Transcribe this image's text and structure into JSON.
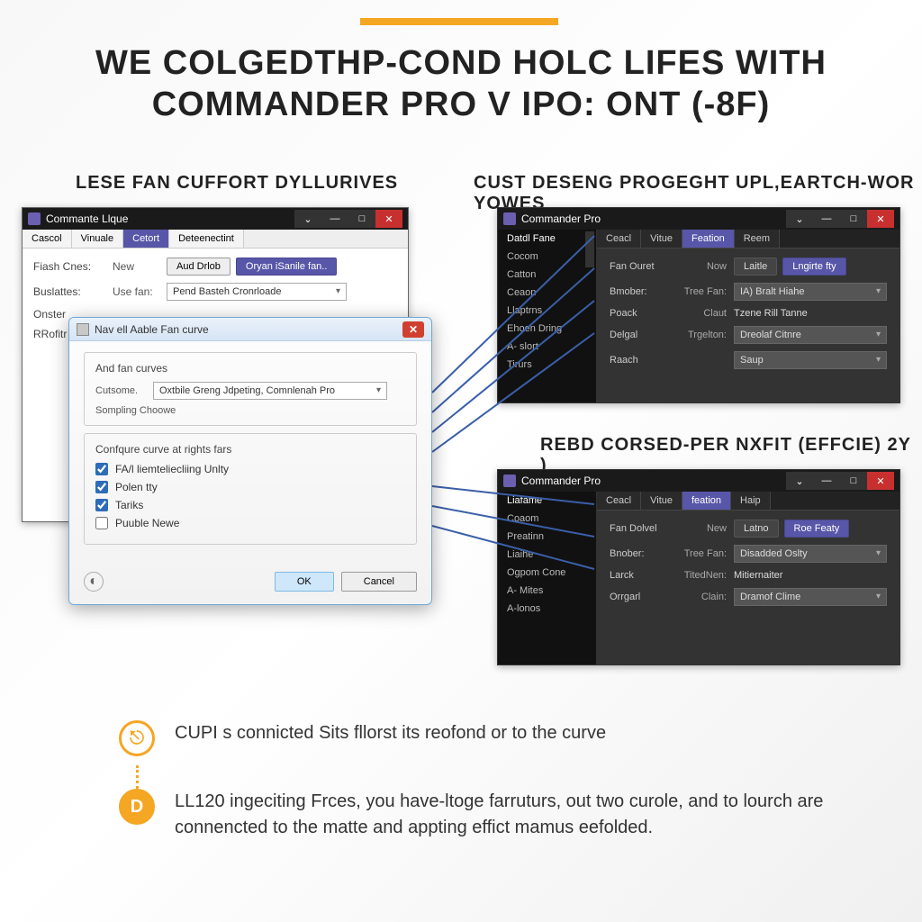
{
  "headline_line1": "WE COLGEDTHP-COND HOLC LIFES WITH",
  "headline_line2": "COMMANDER PRO V IPO: ONT (-8F)",
  "section_left": "LESE FAN CUFFORT DYLLURIVES",
  "section_right_1": "CUST DESENG PROGEGHT UPL,EARTCH-WOR YOWES",
  "section_right_2": "REBD CORSED-PER NXFIT (EFFCIE) 2Y )",
  "win_left": {
    "title": "Commante Llque",
    "tabs": [
      "Cascol",
      "Vinuale",
      "Cetort",
      "Deteenectint"
    ],
    "active_tab": 2,
    "rows": {
      "r1_label": "Fiash Cnes:",
      "r1_sub": "New",
      "r1_btn1": "Aud Drlob",
      "r1_btn2": "Oryan iSanile fan..",
      "r2_label": "Buslattes:",
      "r2_sub": "Use fan:",
      "r2_select": "Pend Basteh Cronrloade",
      "r3_label": "Onster",
      "r4_label": "RRofitr"
    }
  },
  "modal": {
    "title": "Nav ell Aable Fan curve",
    "fs1_legend": "And fan curves",
    "fs1_label": "Cutsome.",
    "fs1_select": "Oxtbile Greng Jdpeting, Comnlenah Pro",
    "fs1_sub": "Sompling Choowe",
    "fs2_legend": "Confqure curve at rights fars",
    "checks": [
      {
        "label": "FA/l liemteliecliing Unlty",
        "checked": true
      },
      {
        "label": "Polen tty",
        "checked": true
      },
      {
        "label": "Tariks",
        "checked": true
      },
      {
        "label": "Puuble Newe",
        "checked": false
      }
    ],
    "ok": "OK",
    "cancel": "Cancel"
  },
  "win_r1": {
    "title": "Commander Pro",
    "side": [
      "Datdl Fane",
      "Cocom",
      "Catton",
      "Ceaon",
      "Llaptrns",
      "Ehoen Dring",
      "A- slort",
      "Tirurs"
    ],
    "tabs": [
      "Ceacl",
      "Vitue",
      "Feation",
      "Reem"
    ],
    "active_tab": 2,
    "rows": [
      {
        "label": "Fan Ouret",
        "sub": "Now",
        "btn1": "Laitle",
        "btn2": "Lngirte fty"
      },
      {
        "label": "Bmober:",
        "sub": "Tree Fan:",
        "select": "IA) Bralt Hiahe"
      },
      {
        "label": "Poack",
        "sub": "Claut",
        "val": "Tzene Rill Tanne"
      },
      {
        "label": "Delgal",
        "sub": "Trgelton:",
        "select": "Dreolaf Citnre"
      },
      {
        "label": "Raach",
        "sub": "",
        "select": "Saup"
      }
    ]
  },
  "win_r2": {
    "title": "Commander Pro",
    "side": [
      "Liafame",
      "Coaom",
      "Preatinn",
      "Liaihe",
      "Ogpom Cone",
      "A- Mites",
      "A-lonos"
    ],
    "tabs": [
      "Ceacl",
      "Vitue",
      "feation",
      "Haip"
    ],
    "active_tab": 2,
    "rows": [
      {
        "label": "Fan Dolvel",
        "sub": "New",
        "btn1": "Latno",
        "btn2": "Roe Featy"
      },
      {
        "label": "Bnober:",
        "sub": "Tree Fan:",
        "select": "Disadded Oslty"
      },
      {
        "label": "Larck",
        "sub": "TitedNen:",
        "val": "Mitiernaiter"
      },
      {
        "label": "Orrgarl",
        "sub": "Clain:",
        "select": "Dramof Clime"
      }
    ]
  },
  "bullets": [
    "CUPI s connicted Sits fllorst its reofond or to the curve",
    "LL120 ingeciting Frces, you have-ltoge farruturs, out two curole, and to lourch are connencted to the matte and appting effict mamus eefolded."
  ]
}
